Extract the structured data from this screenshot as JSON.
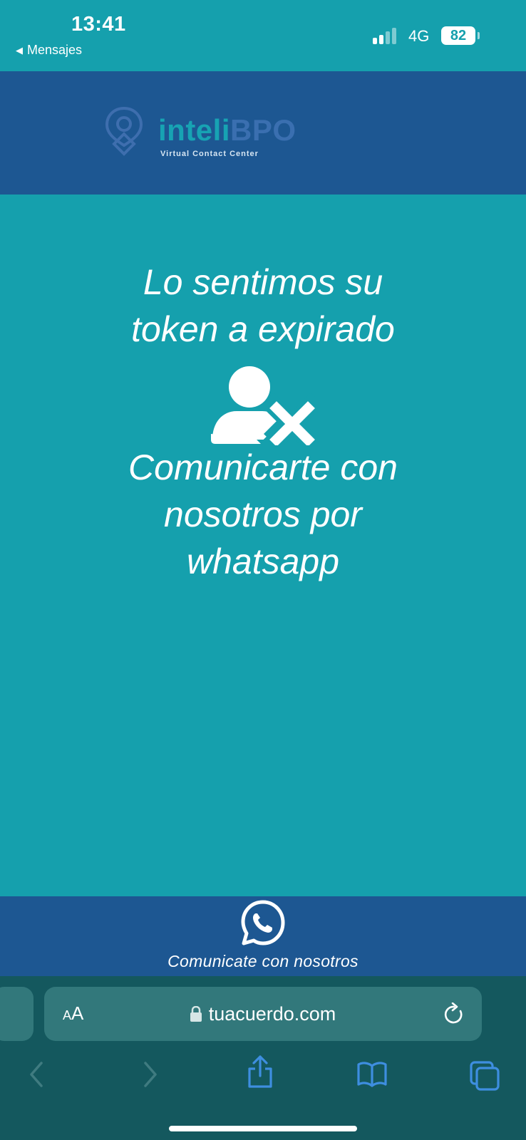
{
  "status_bar": {
    "time": "13:41",
    "back_app_label": "Mensajes",
    "network": "4G",
    "battery": "82"
  },
  "header": {
    "logo_word_part1": "inteli",
    "logo_word_part2": "BPO",
    "logo_subtitle": "Virtual Contact Center"
  },
  "main": {
    "headline_line1": "Lo sentimos su",
    "headline_line2": "token a expirado",
    "message_line1": "Comunicarte con",
    "message_line2": "nosotros por",
    "message_line3": "whatsapp"
  },
  "footer": {
    "label": "Comunicate con nosotros",
    "icon": "whatsapp-icon"
  },
  "browser": {
    "aa_small": "A",
    "aa_large": "A",
    "url": "tuacuerdo.com"
  },
  "colors": {
    "page_bg": "#15a0ad",
    "header_bg": "#1d5792",
    "browser_bg": "#14585e",
    "address_bar_bg": "#32787b",
    "toolbar_icon": "#3e8ee0"
  }
}
